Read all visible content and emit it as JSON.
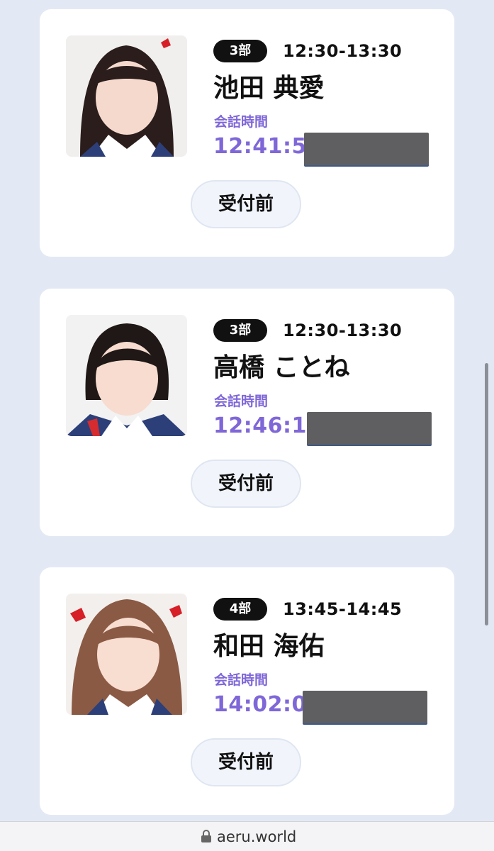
{
  "cards": [
    {
      "part": "3部",
      "time_range": "12:30-13:30",
      "name": "池田 典愛",
      "talk_label": "会話時間",
      "talk_time": "12:41:50",
      "status": "受付前"
    },
    {
      "part": "3部",
      "time_range": "12:30-13:30",
      "name": "高橋 ことね",
      "talk_label": "会話時間",
      "talk_time": "12:46:15",
      "status": "受付前"
    },
    {
      "part": "4部",
      "time_range": "13:45-14:45",
      "name": "和田 海佑",
      "talk_label": "会話時間",
      "talk_time": "14:02:00",
      "status": "受付前"
    }
  ],
  "address_bar": {
    "url": "aeru.world",
    "icon": "lock-icon"
  },
  "colors": {
    "page_background": "#e3e9f4",
    "accent": "#7f67d8",
    "badge": "#111111",
    "button_background": "#f1f5fb"
  }
}
